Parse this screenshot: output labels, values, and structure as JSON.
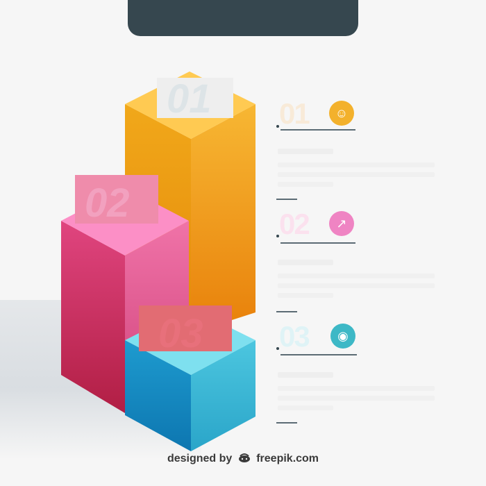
{
  "colors": {
    "header": "#36474f",
    "orange": "#f2a827",
    "pink": "#e9538f",
    "blue": "#35b9d6",
    "rule": "#5b6b74"
  },
  "items": [
    {
      "number": "01",
      "icon": "user-icon",
      "icon_glyph": "☺",
      "color": "#f3b12c",
      "num_color": "#f8ead8"
    },
    {
      "number": "02",
      "icon": "bar-chart-icon",
      "icon_glyph": "↗",
      "color": "#ef84c3",
      "num_color": "#fbe1ee"
    },
    {
      "number": "03",
      "icon": "map-pin-icon",
      "icon_glyph": "◉",
      "color": "#3db8c6",
      "num_color": "#dff3f6"
    }
  ],
  "blocks": [
    {
      "label": "01"
    },
    {
      "label": "02"
    },
    {
      "label": "03"
    }
  ],
  "credit": {
    "prefix": "designed by",
    "brand": "freepik.com",
    "logo": "freepik-logo-icon"
  }
}
